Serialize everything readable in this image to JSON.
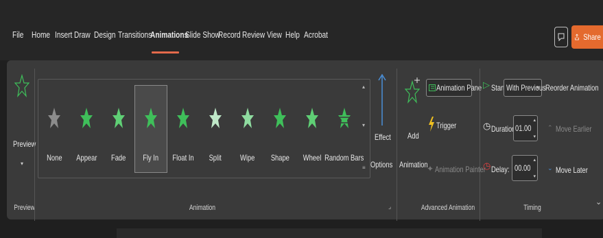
{
  "tabs": [
    "File",
    "Home",
    "Insert",
    "Draw",
    "Design",
    "Transitions",
    "Animations",
    "Slide Show",
    "Record",
    "Review",
    "View",
    "Help",
    "Acrobat"
  ],
  "active_tab": "Animations",
  "share_label": "Share",
  "preview": {
    "label": "Preview",
    "group": "Preview"
  },
  "animations": {
    "items": [
      "None",
      "Appear",
      "Fade",
      "Fly In",
      "Float In",
      "Split",
      "Wipe",
      "Shape",
      "Wheel",
      "Random Bars"
    ],
    "selected": "Fly In",
    "group": "Animation"
  },
  "effect_options": {
    "line1": "Effect",
    "line2": "Options"
  },
  "advanced": {
    "add_line1": "Add",
    "add_line2": "Animation",
    "pane": "Animation Pane",
    "trigger": "Trigger",
    "painter": "Animation Painter",
    "group": "Advanced Animation"
  },
  "timing": {
    "start_label": "Start:",
    "start_value": "With Previous",
    "duration_label": "Duration:",
    "duration_value": "01.00",
    "delay_label": "Delay:",
    "delay_value": "00.00",
    "reorder": "Reorder Animation",
    "earlier": "Move Earlier",
    "later": "Move Later",
    "group": "Timing"
  },
  "colors": {
    "accent": "#e46a2e",
    "star_green": "#3fbf5a",
    "ribbon": "#3a3a3a"
  }
}
